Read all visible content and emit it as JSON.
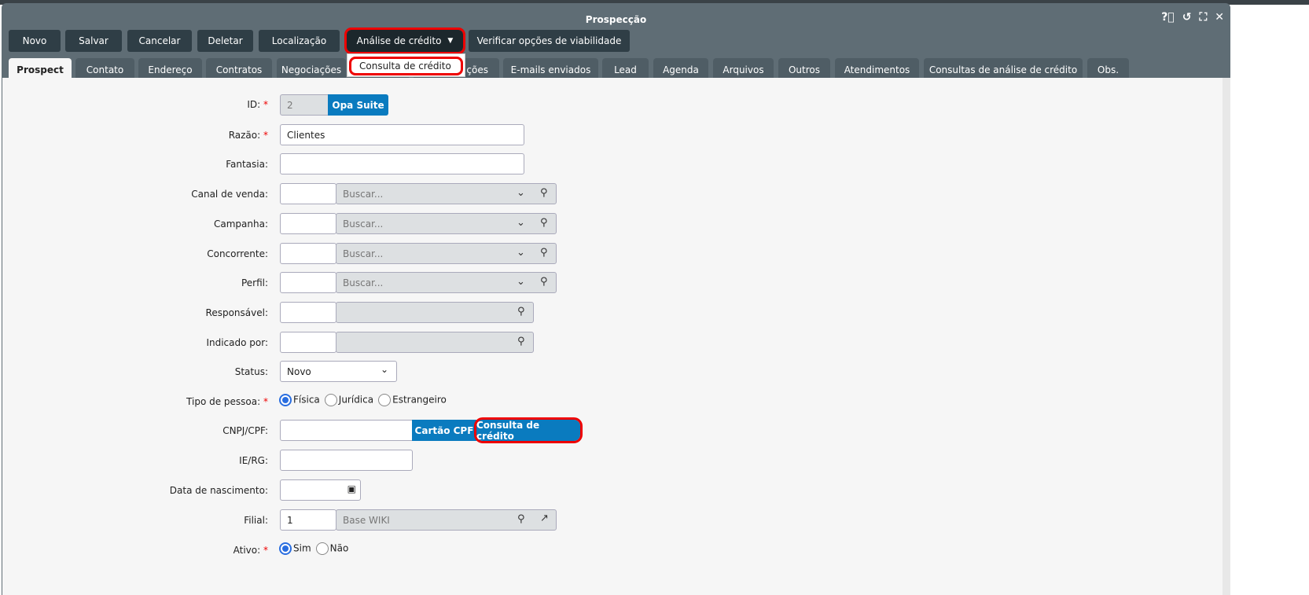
{
  "window": {
    "title": "Prospecção",
    "icons": [
      "help-icon",
      "history-icon",
      "fullscreen-icon",
      "close-icon"
    ]
  },
  "toolbar": [
    "Novo",
    "Salvar",
    "Cancelar",
    "Deletar",
    "Localização",
    "Análise de crédito",
    "Verificar opções de viabilidade"
  ],
  "dropdown": {
    "items": [
      "Consulta de crédito"
    ]
  },
  "tabs": [
    "Prospect",
    "Contato",
    "Endereço",
    "Contratos",
    "Negociações",
    "",
    "ções",
    "E-mails enviados",
    "Lead",
    "Agenda",
    "Arquivos",
    "Outros",
    "Atendimentos",
    "Consultas de análise de crédito",
    "Obs."
  ],
  "form": {
    "id": {
      "label": "ID:",
      "value": "2",
      "button": "Opa Suite"
    },
    "razao": {
      "label": "Razão:",
      "value": "Clientes"
    },
    "fantasia": {
      "label": "Fantasia:",
      "value": ""
    },
    "canal": {
      "label": "Canal de venda:",
      "placeholder": "Buscar..."
    },
    "campanha": {
      "label": "Campanha:",
      "placeholder": "Buscar..."
    },
    "concorrente": {
      "label": "Concorrente:",
      "placeholder": "Buscar..."
    },
    "perfil": {
      "label": "Perfil:",
      "placeholder": "Buscar..."
    },
    "responsavel": {
      "label": "Responsável:"
    },
    "indicado": {
      "label": "Indicado por:"
    },
    "status": {
      "label": "Status:",
      "value": "Novo"
    },
    "tipo": {
      "label": "Tipo de pessoa:",
      "options": [
        "Física",
        "Jurídica",
        "Estrangeiro"
      ],
      "selected": "Física"
    },
    "cnpj": {
      "label": "CNPJ/CPF:",
      "button1": "Cartão CPF",
      "button2": "Consulta de crédito"
    },
    "ie": {
      "label": "IE/RG:"
    },
    "nascimento": {
      "label": "Data de nascimento:"
    },
    "filial": {
      "label": "Filial:",
      "code": "1",
      "name": "Base WIKI"
    },
    "ativo": {
      "label": "Ativo:",
      "options": [
        "Sim",
        "Não"
      ],
      "selected": "Sim"
    }
  },
  "colors": {
    "accent": "#0a7bbf",
    "highlight": "#e00000",
    "toolbar": "#2f3e46"
  }
}
